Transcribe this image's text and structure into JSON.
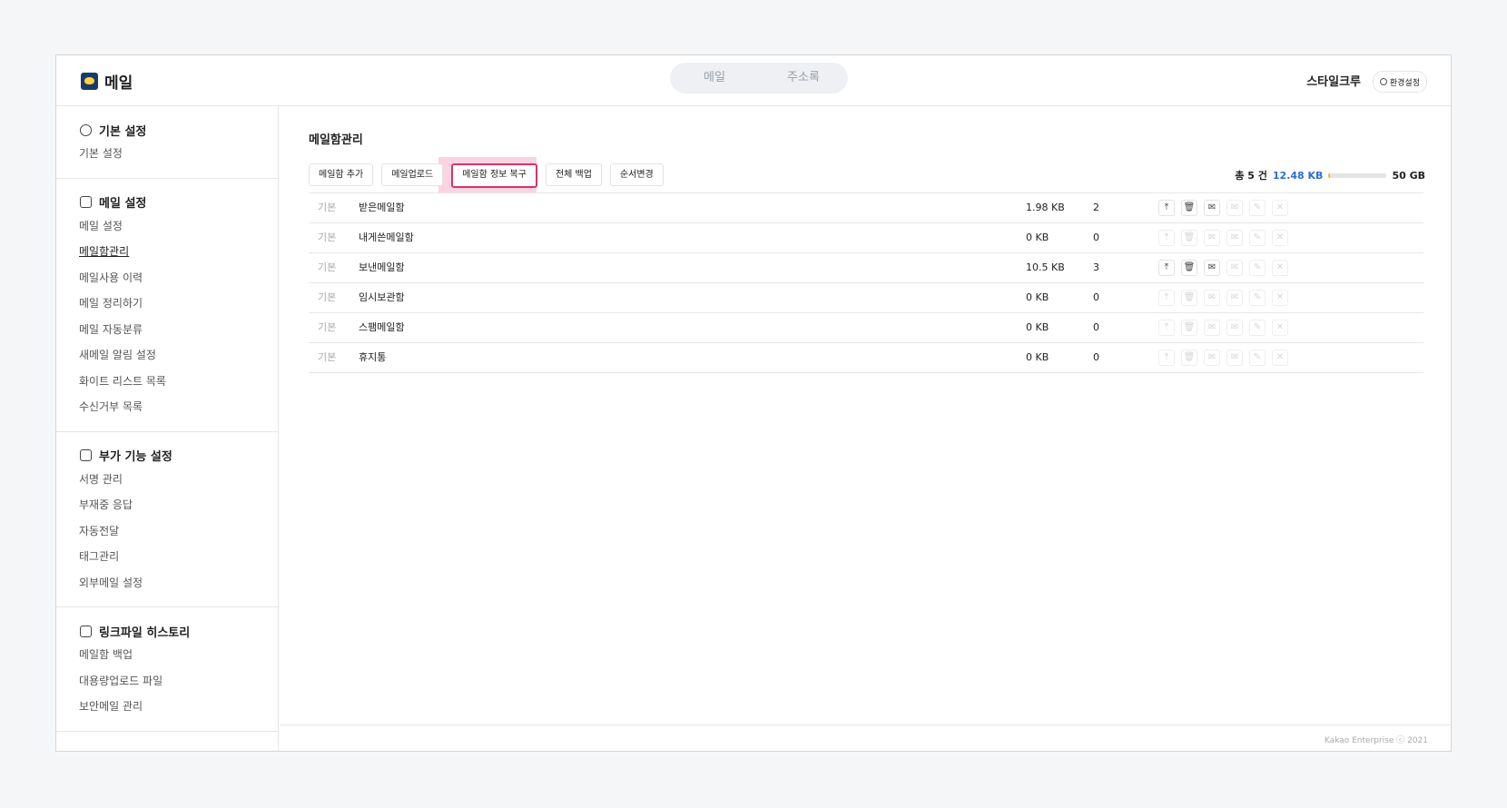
{
  "app": {
    "logo_text": "메일"
  },
  "top_tabs": [
    {
      "label": "메일"
    },
    {
      "label": "주소록"
    }
  ],
  "user": {
    "name": "스타일크루",
    "settings_label": "환경설정"
  },
  "sidebar": {
    "sections": [
      {
        "title": "기본 설정",
        "icon": "gear-icon",
        "items": [
          "기본 설정"
        ]
      },
      {
        "title": "메일 설정",
        "icon": "mail-settings-icon",
        "items": [
          "메일 설정",
          "메일함관리",
          "메일사용 이력",
          "메일 정리하기",
          "메일 자동분류",
          "새메일 알림 설정",
          "화이트 리스트 목록",
          "수신거부 목록"
        ]
      },
      {
        "title": "부가 기능 설정",
        "icon": "mail-plus-icon",
        "items": [
          "서명 관리",
          "부재중 응답",
          "자동전달",
          "태그관리",
          "외부메일 설정"
        ]
      },
      {
        "title": "링크파일 히스토리",
        "icon": "paperclip-icon",
        "items": [
          "메일함 백업",
          "대용량업로드 파일",
          "보안메일 관리"
        ]
      }
    ]
  },
  "main": {
    "title": "메일함관리",
    "toolbar": [
      "메일함 추가",
      "메일업로드",
      "메일함 정보 복구",
      "전체 백업",
      "순서변경"
    ],
    "quota": {
      "total_label": "총 5 건",
      "used": "12.48 KB",
      "limit": "50 GB",
      "fill_percent": 3
    },
    "rows": [
      {
        "type": "기본",
        "name": "받은메일함",
        "size": "1.98 KB",
        "count": "2",
        "enabled": [
          true,
          true,
          true,
          false,
          false,
          false
        ]
      },
      {
        "type": "기본",
        "name": "내게쓴메일함",
        "size": "0 KB",
        "count": "0",
        "enabled": [
          false,
          false,
          false,
          false,
          false,
          false
        ]
      },
      {
        "type": "기본",
        "name": "보낸메일함",
        "size": "10.5 KB",
        "count": "3",
        "enabled": [
          true,
          true,
          true,
          false,
          false,
          false
        ]
      },
      {
        "type": "기본",
        "name": "임시보관함",
        "size": "0 KB",
        "count": "0",
        "enabled": [
          false,
          false,
          false,
          false,
          false,
          false
        ]
      },
      {
        "type": "기본",
        "name": "스팸메일함",
        "size": "0 KB",
        "count": "0",
        "enabled": [
          false,
          false,
          false,
          false,
          false,
          false
        ]
      },
      {
        "type": "기본",
        "name": "휴지통",
        "size": "0 KB",
        "count": "0",
        "enabled": [
          false,
          false,
          false,
          false,
          false,
          false
        ]
      }
    ],
    "actions": [
      {
        "name": "upload-icon",
        "glyph": "⤒"
      },
      {
        "name": "trash-icon",
        "glyph": "🗑"
      },
      {
        "name": "mail-move-icon",
        "glyph": "✉"
      },
      {
        "name": "mail-export-icon",
        "glyph": "✉"
      },
      {
        "name": "pencil-icon",
        "glyph": "✎"
      },
      {
        "name": "close-icon",
        "glyph": "✕"
      }
    ]
  },
  "footer": {
    "copyright": "Kakao Enterprise ⓒ 2021"
  }
}
